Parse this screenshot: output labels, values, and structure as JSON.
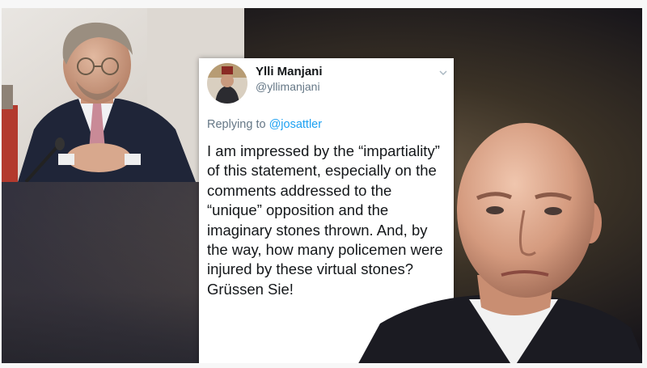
{
  "tweet": {
    "name": "Ylli Manjani",
    "handle": "@yllimanjani",
    "replying_prefix": "Replying to",
    "replying_to": "@josattler",
    "text": "I am impressed by the “impartiality” of this statement, especially on the comments addressed to the “unique” opposition and the imaginary stones thrown. And, by the way, how many policemen were injured by these virtual stones? Grüssen Sie!"
  },
  "icons": {
    "tweet_menu": "chevron-down-icon"
  },
  "colors": {
    "background_dark": "#17151a",
    "background_warm": "#6a5a45",
    "tweet_bg": "#ffffff",
    "tweet_text": "#14171a",
    "tweet_muted": "#657786",
    "mention": "#1da1f2"
  }
}
